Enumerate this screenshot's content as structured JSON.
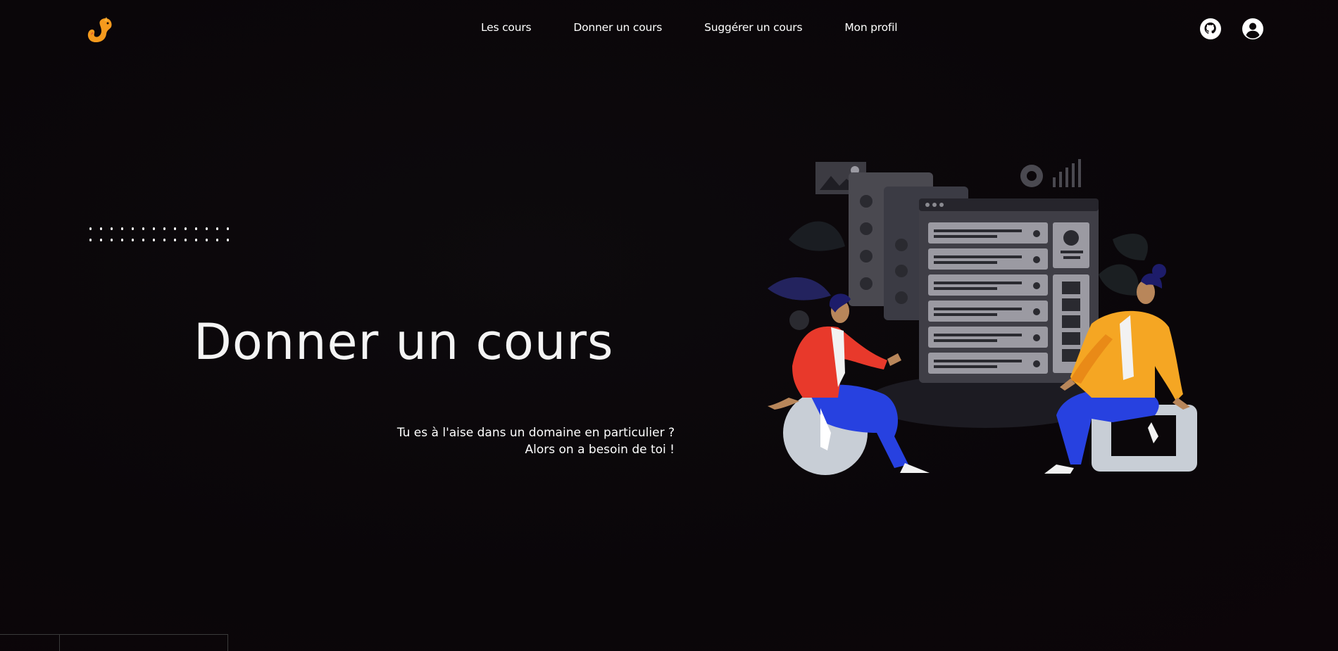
{
  "nav": {
    "logo_icon": "squirrel-logo-icon",
    "links": [
      {
        "label": "Les cours"
      },
      {
        "label": "Donner un cours"
      },
      {
        "label": "Suggérer un cours"
      },
      {
        "label": "Mon profil"
      }
    ],
    "github_icon": "github-icon",
    "profile_icon": "user-circle-icon"
  },
  "hero": {
    "title": "Donner un cours",
    "subtitle_line1": "Tu es à l'aise dans un domaine en particulier ?",
    "subtitle_line2": "Alors on a besoin de toi !",
    "illustration": "two-people-dashboard-illustration"
  },
  "colors": {
    "background": "#0b070a",
    "accent_orange": "#f5a623",
    "accent_red": "#e8392b",
    "accent_blue": "#2a45e8",
    "text": "#ffffff"
  }
}
